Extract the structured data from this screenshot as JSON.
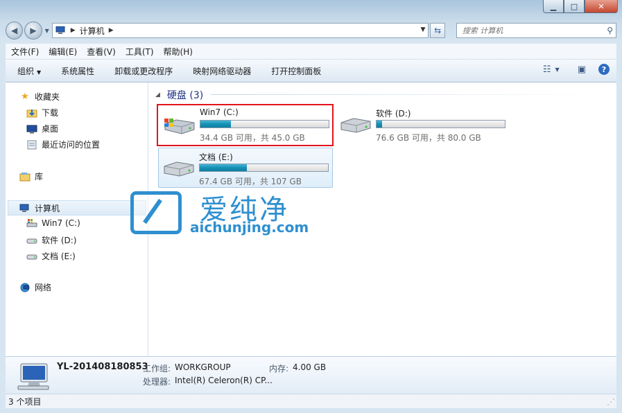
{
  "window": {
    "caption": {
      "minimize": "▁",
      "maximize": "□",
      "close": "✕"
    }
  },
  "nav": {
    "breadcrumb": "计算机",
    "search_placeholder": "搜索 计算机"
  },
  "menu": [
    "文件(F)",
    "编辑(E)",
    "查看(V)",
    "工具(T)",
    "帮助(H)"
  ],
  "commands": {
    "organize": "组织",
    "system_properties": "系统属性",
    "uninstall": "卸载或更改程序",
    "map_drive": "映射网络驱动器",
    "control_panel": "打开控制面板"
  },
  "sidebar": {
    "favorites": "收藏夹",
    "downloads": "下载",
    "desktop": "桌面",
    "recent": "最近访问的位置",
    "library": "库",
    "computer": "计算机",
    "drive_c": "Win7 (C:)",
    "drive_d": "软件 (D:)",
    "drive_e": "文档 (E:)",
    "network": "网络"
  },
  "watermark": {
    "title": "爱纯净",
    "url": "aichunjing.com"
  },
  "group": {
    "header": "硬盘 (3)"
  },
  "drives": [
    {
      "name": "Win7 (C:)",
      "free": "34.4 GB 可用，共 45.0 GB",
      "used_fraction": 0.236
    },
    {
      "name": "软件 (D:)",
      "free": "76.6 GB 可用，共 80.0 GB",
      "used_fraction": 0.043
    },
    {
      "name": "文档 (E:)",
      "free": "67.4 GB 可用，共 107 GB",
      "used_fraction": 0.37
    }
  ],
  "details": {
    "computer_name": "YL-201408180853",
    "workgroup_label": "工作组:",
    "workgroup_value": "WORKGROUP",
    "memory_label": "内存:",
    "memory_value": "4.00 GB",
    "cpu_label": "处理器:",
    "cpu_value": "Intel(R) Celeron(R) CP..."
  },
  "status": {
    "items": "3 个项目"
  }
}
